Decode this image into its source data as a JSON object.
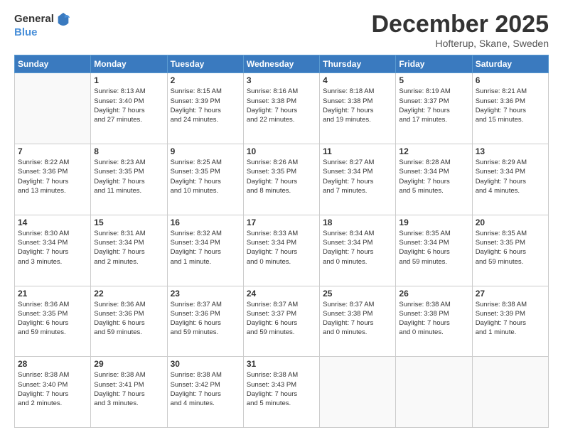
{
  "logo": {
    "general": "General",
    "blue": "Blue"
  },
  "header": {
    "month": "December 2025",
    "location": "Hofterup, Skane, Sweden"
  },
  "weekdays": [
    "Sunday",
    "Monday",
    "Tuesday",
    "Wednesday",
    "Thursday",
    "Friday",
    "Saturday"
  ],
  "weeks": [
    [
      {
        "day": "",
        "info": ""
      },
      {
        "day": "1",
        "info": "Sunrise: 8:13 AM\nSunset: 3:40 PM\nDaylight: 7 hours\nand 27 minutes."
      },
      {
        "day": "2",
        "info": "Sunrise: 8:15 AM\nSunset: 3:39 PM\nDaylight: 7 hours\nand 24 minutes."
      },
      {
        "day": "3",
        "info": "Sunrise: 8:16 AM\nSunset: 3:38 PM\nDaylight: 7 hours\nand 22 minutes."
      },
      {
        "day": "4",
        "info": "Sunrise: 8:18 AM\nSunset: 3:38 PM\nDaylight: 7 hours\nand 19 minutes."
      },
      {
        "day": "5",
        "info": "Sunrise: 8:19 AM\nSunset: 3:37 PM\nDaylight: 7 hours\nand 17 minutes."
      },
      {
        "day": "6",
        "info": "Sunrise: 8:21 AM\nSunset: 3:36 PM\nDaylight: 7 hours\nand 15 minutes."
      }
    ],
    [
      {
        "day": "7",
        "info": "Sunrise: 8:22 AM\nSunset: 3:36 PM\nDaylight: 7 hours\nand 13 minutes."
      },
      {
        "day": "8",
        "info": "Sunrise: 8:23 AM\nSunset: 3:35 PM\nDaylight: 7 hours\nand 11 minutes."
      },
      {
        "day": "9",
        "info": "Sunrise: 8:25 AM\nSunset: 3:35 PM\nDaylight: 7 hours\nand 10 minutes."
      },
      {
        "day": "10",
        "info": "Sunrise: 8:26 AM\nSunset: 3:35 PM\nDaylight: 7 hours\nand 8 minutes."
      },
      {
        "day": "11",
        "info": "Sunrise: 8:27 AM\nSunset: 3:34 PM\nDaylight: 7 hours\nand 7 minutes."
      },
      {
        "day": "12",
        "info": "Sunrise: 8:28 AM\nSunset: 3:34 PM\nDaylight: 7 hours\nand 5 minutes."
      },
      {
        "day": "13",
        "info": "Sunrise: 8:29 AM\nSunset: 3:34 PM\nDaylight: 7 hours\nand 4 minutes."
      }
    ],
    [
      {
        "day": "14",
        "info": "Sunrise: 8:30 AM\nSunset: 3:34 PM\nDaylight: 7 hours\nand 3 minutes."
      },
      {
        "day": "15",
        "info": "Sunrise: 8:31 AM\nSunset: 3:34 PM\nDaylight: 7 hours\nand 2 minutes."
      },
      {
        "day": "16",
        "info": "Sunrise: 8:32 AM\nSunset: 3:34 PM\nDaylight: 7 hours\nand 1 minute."
      },
      {
        "day": "17",
        "info": "Sunrise: 8:33 AM\nSunset: 3:34 PM\nDaylight: 7 hours\nand 0 minutes."
      },
      {
        "day": "18",
        "info": "Sunrise: 8:34 AM\nSunset: 3:34 PM\nDaylight: 7 hours\nand 0 minutes."
      },
      {
        "day": "19",
        "info": "Sunrise: 8:35 AM\nSunset: 3:34 PM\nDaylight: 6 hours\nand 59 minutes."
      },
      {
        "day": "20",
        "info": "Sunrise: 8:35 AM\nSunset: 3:35 PM\nDaylight: 6 hours\nand 59 minutes."
      }
    ],
    [
      {
        "day": "21",
        "info": "Sunrise: 8:36 AM\nSunset: 3:35 PM\nDaylight: 6 hours\nand 59 minutes."
      },
      {
        "day": "22",
        "info": "Sunrise: 8:36 AM\nSunset: 3:36 PM\nDaylight: 6 hours\nand 59 minutes."
      },
      {
        "day": "23",
        "info": "Sunrise: 8:37 AM\nSunset: 3:36 PM\nDaylight: 6 hours\nand 59 minutes."
      },
      {
        "day": "24",
        "info": "Sunrise: 8:37 AM\nSunset: 3:37 PM\nDaylight: 6 hours\nand 59 minutes."
      },
      {
        "day": "25",
        "info": "Sunrise: 8:37 AM\nSunset: 3:38 PM\nDaylight: 7 hours\nand 0 minutes."
      },
      {
        "day": "26",
        "info": "Sunrise: 8:38 AM\nSunset: 3:38 PM\nDaylight: 7 hours\nand 0 minutes."
      },
      {
        "day": "27",
        "info": "Sunrise: 8:38 AM\nSunset: 3:39 PM\nDaylight: 7 hours\nand 1 minute."
      }
    ],
    [
      {
        "day": "28",
        "info": "Sunrise: 8:38 AM\nSunset: 3:40 PM\nDaylight: 7 hours\nand 2 minutes."
      },
      {
        "day": "29",
        "info": "Sunrise: 8:38 AM\nSunset: 3:41 PM\nDaylight: 7 hours\nand 3 minutes."
      },
      {
        "day": "30",
        "info": "Sunrise: 8:38 AM\nSunset: 3:42 PM\nDaylight: 7 hours\nand 4 minutes."
      },
      {
        "day": "31",
        "info": "Sunrise: 8:38 AM\nSunset: 3:43 PM\nDaylight: 7 hours\nand 5 minutes."
      },
      {
        "day": "",
        "info": ""
      },
      {
        "day": "",
        "info": ""
      },
      {
        "day": "",
        "info": ""
      }
    ]
  ]
}
